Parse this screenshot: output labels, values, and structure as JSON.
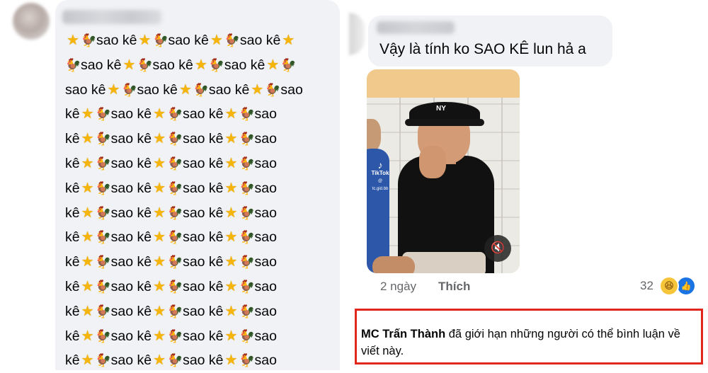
{
  "left_comment": {
    "lines": [
      [
        "star",
        "chick",
        "sao kê",
        "star",
        "chick",
        "sao kê",
        "star",
        "chick",
        "sao kê",
        "star"
      ],
      [
        "chick",
        "sao kê",
        "star",
        "chick",
        "sao kê",
        "star",
        "chick",
        "sao kê",
        "star",
        "chick"
      ],
      [
        "sao kê",
        "star",
        "chick",
        "sao kê",
        "star",
        "chick",
        "sao kê",
        "star",
        "chick",
        "sao"
      ],
      [
        "kê",
        "star",
        "chick",
        "sao kê",
        "star",
        "chick",
        "sao kê",
        "star",
        "chick",
        "sao"
      ],
      [
        "kê",
        "star",
        "chick",
        "sao kê",
        "star",
        "chick",
        "sao kê",
        "star",
        "chick",
        "sao"
      ],
      [
        "kê",
        "star",
        "chick",
        "sao kê",
        "star",
        "chick",
        "sao kê",
        "star",
        "chick",
        "sao"
      ],
      [
        "kê",
        "star",
        "chick",
        "sao kê",
        "star",
        "chick",
        "sao kê",
        "star",
        "chick",
        "sao"
      ],
      [
        "kê",
        "star",
        "chick",
        "sao kê",
        "star",
        "chick",
        "sao kê",
        "star",
        "chick",
        "sao"
      ],
      [
        "kê",
        "star",
        "chick",
        "sao kê",
        "star",
        "chick",
        "sao kê",
        "star",
        "chick",
        "sao"
      ],
      [
        "kê",
        "star",
        "chick",
        "sao kê",
        "star",
        "chick",
        "sao kê",
        "star",
        "chick",
        "sao"
      ],
      [
        "kê",
        "star",
        "chick",
        "sao kê",
        "star",
        "chick",
        "sao kê",
        "star",
        "chick",
        "sao"
      ],
      [
        "kê",
        "star",
        "chick",
        "sao kê",
        "star",
        "chick",
        "sao kê",
        "star",
        "chick",
        "sao"
      ],
      [
        "kê",
        "star",
        "chick",
        "sao kê",
        "star",
        "chick",
        "sao kê",
        "star",
        "chick",
        "sao"
      ],
      [
        "kê",
        "star",
        "chick",
        "sao kê",
        "star",
        "chick",
        "sao kê",
        "star",
        "chick",
        "sao"
      ]
    ],
    "icons": {
      "star": "star-emoji-icon",
      "chick": "rooster-emoji-icon"
    }
  },
  "right_comment": {
    "text": "Vậy là tính ko SAO KÊ lun hả a",
    "video": {
      "watermark_app": "TikTok",
      "watermark_handle": "@ tc.gid.bb",
      "hat_logo": "NY",
      "mute_icon": "speaker-muted-icon"
    },
    "time": "2 ngày",
    "like_label": "Thích",
    "reaction_count": "32",
    "reactions": [
      "haha-reaction-icon",
      "like-reaction-icon"
    ]
  },
  "notice": {
    "author": "MC Trấn Thành",
    "text": " đã giới hạn những người có thể bình luận về viết này.",
    "border_color": "#e1261c"
  }
}
